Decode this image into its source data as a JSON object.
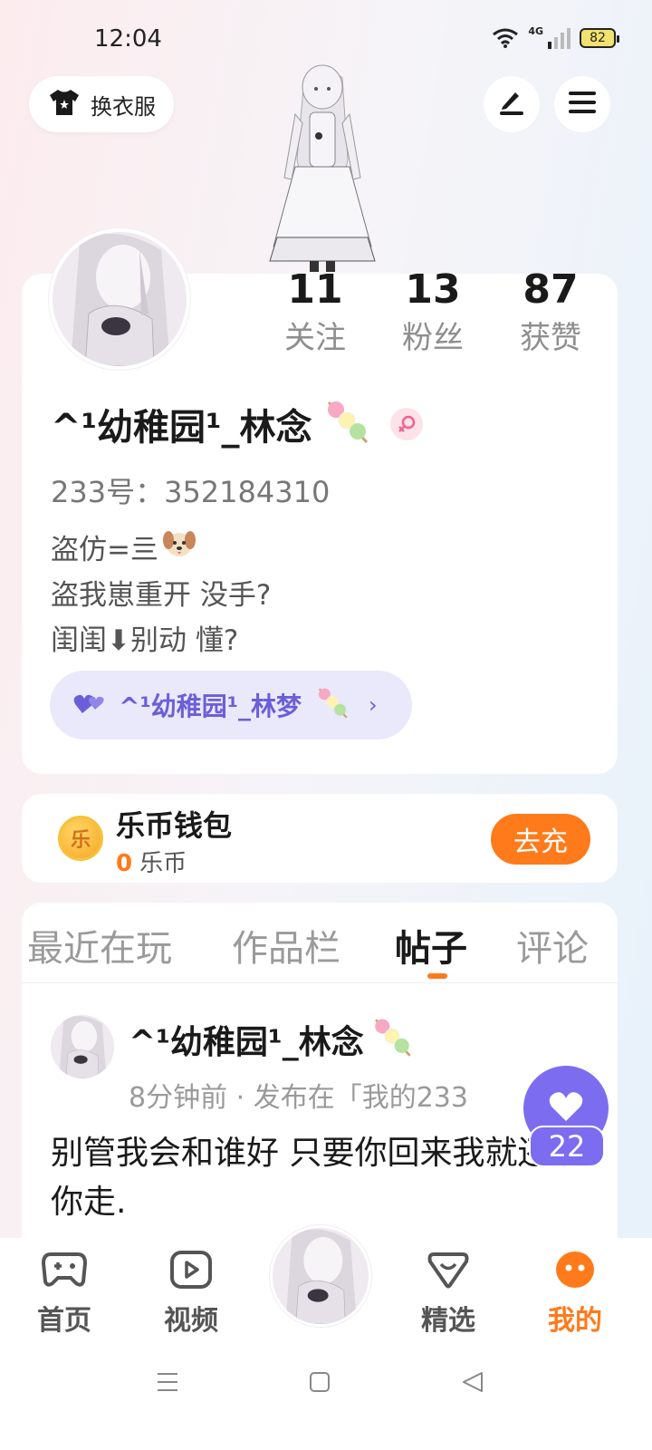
{
  "status_bar": {
    "time": "12:04",
    "network": "4G",
    "battery": "82"
  },
  "header": {
    "outfit_label": "换衣服"
  },
  "profile": {
    "stats": [
      {
        "value": "11",
        "label": "关注"
      },
      {
        "value": "13",
        "label": "粉丝"
      },
      {
        "value": "87",
        "label": "获赞"
      }
    ],
    "nickname": "^¹幼稚园¹_林念",
    "user_id": "233号：352184310",
    "bio": [
      "盗仿=亖",
      "盗我崽重开 没手?",
      "闺闺⬇别动 懂?"
    ],
    "partner_name": "^¹幼稚园¹_林梦",
    "partner_arrow": "›"
  },
  "wallet": {
    "title": "乐币钱包",
    "balance": "0",
    "unit": "乐币",
    "coin_glyph": "乐",
    "recharge_label": "去充"
  },
  "tabs": [
    {
      "label": "最近在玩"
    },
    {
      "label": "作品栏"
    },
    {
      "label": "帖子"
    },
    {
      "label": "评论"
    }
  ],
  "post": {
    "author": "^¹幼稚园¹_林念",
    "meta": "8分钟前 · 发布在「我的233",
    "text": "别管我会和谁好 只要你回来我就还跟你走."
  },
  "like_count": "22",
  "bottom_nav": [
    {
      "label": "首页",
      "icon": "gamepad-icon"
    },
    {
      "label": "视频",
      "icon": "video-play-icon"
    },
    {
      "label": "精选",
      "icon": "heart-badge-icon"
    },
    {
      "label": "我的",
      "icon": "smile-face-icon"
    }
  ],
  "colors": {
    "accent": "#ff7a1a",
    "purple": "#7c6df0",
    "partner_bg": "#eae8fb"
  }
}
